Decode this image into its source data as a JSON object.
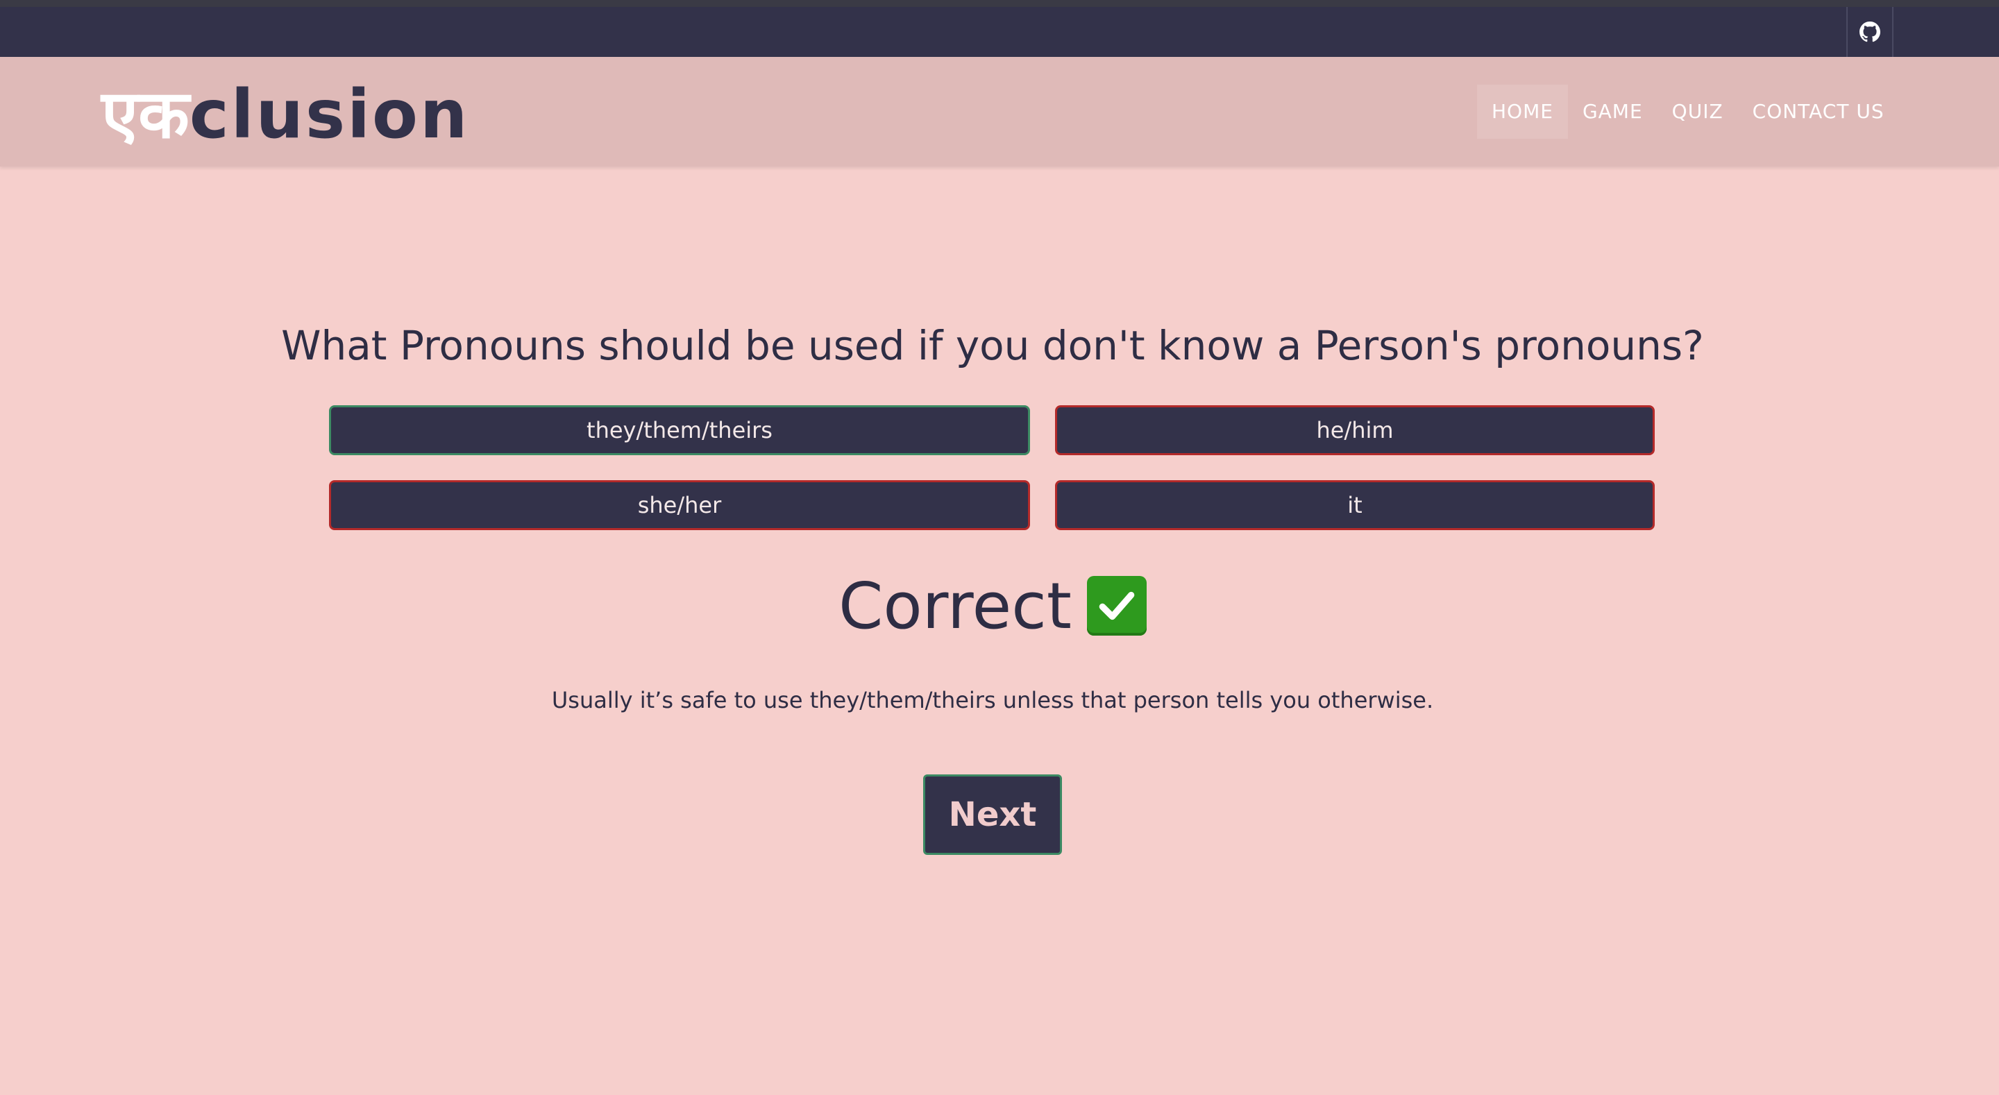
{
  "brand": {
    "hindi": "एक",
    "latin": "clusion"
  },
  "nav": {
    "home": "HOME",
    "game": "GAME",
    "quiz": "QUIZ",
    "contact": "CONTACT US"
  },
  "topbar": {
    "icon": "github-icon"
  },
  "quiz": {
    "question": "What Pronouns should be used if you don't know a Person's pronouns?",
    "options": [
      "they/them/theirs",
      "he/him",
      "she/her",
      "it"
    ],
    "result": "Correct",
    "result_icon": "check-mark-icon",
    "explanation": "Usually it’s safe to use they/them/theirs unless that person tells you otherwise.",
    "next_label": "Next"
  },
  "colors": {
    "background": "#f6cfcc",
    "navbar": "#dfbab8",
    "topbar": "#33324a",
    "button": "#33324a",
    "correct_border": "#3c8a63",
    "wrong_border": "#b32a2a",
    "check_green": "#2e9a1e"
  }
}
